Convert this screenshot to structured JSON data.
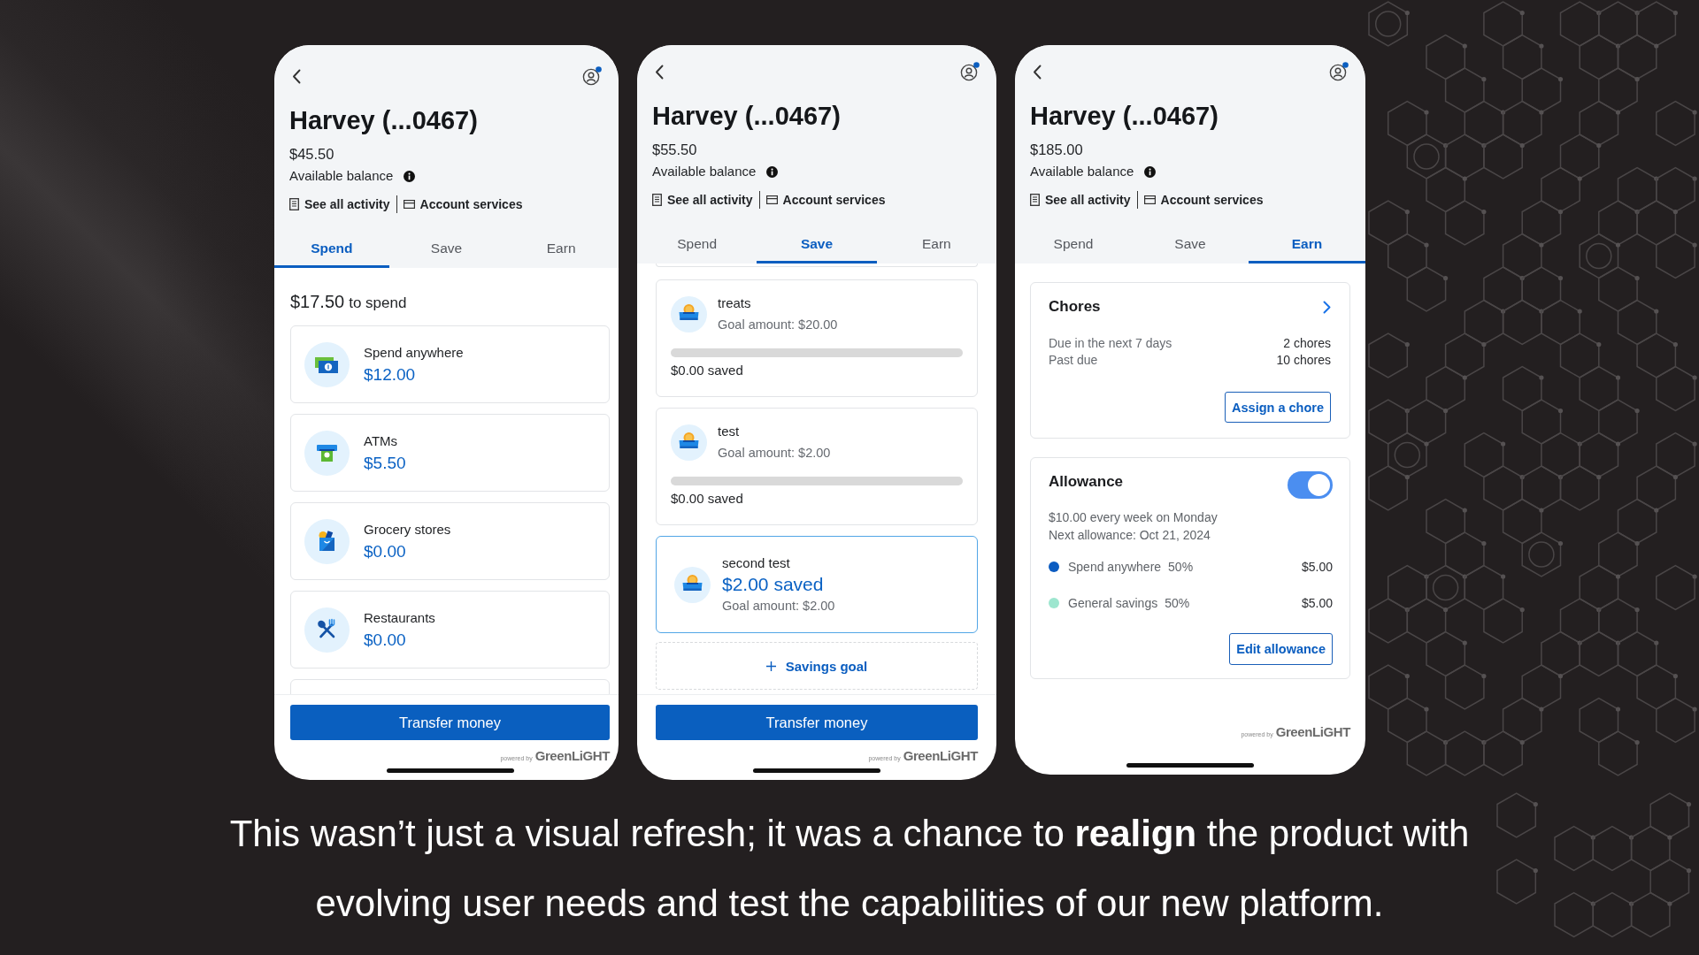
{
  "screens": [
    {
      "title": "Harvey (...0467)",
      "balance": "$45.50",
      "balance_label": "Available balance",
      "links": [
        "See all activity",
        "Account services"
      ],
      "tabs": [
        {
          "label": "Spend",
          "selected": true
        },
        {
          "label": "Save",
          "selected": false
        },
        {
          "label": "Earn",
          "selected": false
        }
      ],
      "spend": {
        "amount": "$17.50",
        "label": "to spend",
        "categories": [
          {
            "name": "Spend anywhere",
            "amount": "$12.00"
          },
          {
            "name": "ATMs",
            "amount": "$5.50"
          },
          {
            "name": "Grocery stores",
            "amount": "$0.00"
          },
          {
            "name": "Restaurants",
            "amount": "$0.00"
          }
        ]
      },
      "primary_button": "Transfer money",
      "powered_by": "powered by",
      "logo": "GreenLiGHT"
    },
    {
      "title": "Harvey (...0467)",
      "balance": "$55.50",
      "balance_label": "Available balance",
      "links": [
        "See all activity",
        "Account services"
      ],
      "tabs": [
        {
          "label": "Spend",
          "selected": false
        },
        {
          "label": "Save",
          "selected": true
        },
        {
          "label": "Earn",
          "selected": false
        }
      ],
      "save": {
        "goals": [
          {
            "kind": "progress",
            "name": "treats",
            "goal": "Goal amount: $20.00",
            "level": 0,
            "saved": "$0.00 saved"
          },
          {
            "kind": "progress",
            "name": "test",
            "goal": "Goal amount: $2.00",
            "level": 0,
            "saved": "$0.00 saved"
          },
          {
            "kind": "reached",
            "name": "second test",
            "saved": "$2.00 saved",
            "goal": "Goal amount: $2.00"
          }
        ],
        "add_button": "Savings goal"
      },
      "primary_button": "Transfer money",
      "powered_by": "powered by",
      "logo": "GreenLiGHT"
    },
    {
      "title": "Harvey (...0467)",
      "balance": "$185.00",
      "balance_label": "Available balance",
      "links": [
        "See all activity",
        "Account services"
      ],
      "tabs": [
        {
          "label": "Spend",
          "selected": false
        },
        {
          "label": "Save",
          "selected": false
        },
        {
          "label": "Earn",
          "selected": true
        }
      ],
      "earn": {
        "chores": {
          "title": "Chores",
          "rows": [
            {
              "label": "Due in the next 7 days",
              "value": "2 chores"
            },
            {
              "label": "Past due",
              "value": "10 chores"
            }
          ],
          "button": "Assign a chore"
        },
        "allowance": {
          "title": "Allowance",
          "on": true,
          "schedule": [
            "$10.00 every week on Monday",
            "Next allowance: Oct 21, 2024"
          ],
          "splits": [
            {
              "name": "Spend anywhere",
              "percent": "50%",
              "amount": "$5.00",
              "color": "#0b5cc1"
            },
            {
              "name": "General savings",
              "percent": "50%",
              "amount": "$5.00",
              "color": "#9de6cf"
            }
          ],
          "button": "Edit allowance"
        }
      },
      "powered_by": "powered by",
      "logo": "GreenLiGHT"
    }
  ],
  "caption": "This wasn’t just a visual refresh; it was a chance to **realign** the product with evolving user needs and test the capabilities of our new platform."
}
